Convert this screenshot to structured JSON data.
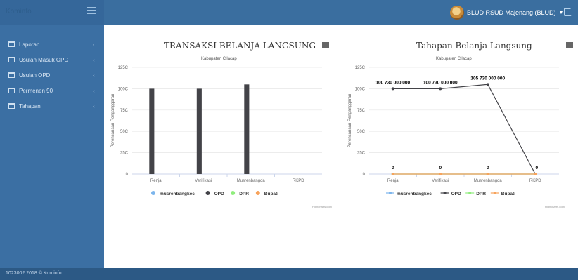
{
  "header": {
    "brand": "Kominfo",
    "user_label": "BLUD RSUD Majenang (BLUD)"
  },
  "sidebar": {
    "items": [
      {
        "label": "Laporan"
      },
      {
        "label": "Usulan Masuk OPD"
      },
      {
        "label": "Usulan OPD"
      },
      {
        "label": "Permenen 90"
      },
      {
        "label": "Tahapan"
      }
    ]
  },
  "footer": {
    "text": "1023002 2018 © Kominfo"
  },
  "colors": {
    "accent": "#3a6e9f",
    "sidebar": "#3b6fa3",
    "musrenbangkec": "#7cb5ec",
    "opd": "#434348",
    "dpr": "#90ed7d",
    "bupati": "#f7a35c"
  },
  "chart_data": [
    {
      "type": "bar",
      "title": "TRANSAKSI BELANJA LANGSUNG",
      "subtitle": "Kabupaten Cilacap",
      "ylabel": "Perencanaan Penganggaran",
      "ylim": [
        0,
        125
      ],
      "yticks": [
        "0",
        "25C",
        "50C",
        "75C",
        "100C",
        "125C"
      ],
      "categories": [
        "Renja",
        "Verifikasi",
        "Musrenbangda",
        "RKPD"
      ],
      "series": [
        {
          "name": "musrenbangkec",
          "values": [
            0,
            0,
            0,
            0
          ]
        },
        {
          "name": "OPD",
          "values": [
            100,
            100,
            105,
            0
          ]
        },
        {
          "name": "DPR",
          "values": [
            0,
            0,
            0,
            0
          ]
        },
        {
          "name": "Bupati",
          "values": [
            0,
            0,
            0,
            0
          ]
        }
      ],
      "credit": "Highcharts.com",
      "legend": "bottom"
    },
    {
      "type": "line",
      "title": "Tahapan Belanja Langsung",
      "subtitle": "Kabupaten Cilacap",
      "ylabel": "Perencanaan Penganggaran",
      "ylim": [
        0,
        125
      ],
      "yticks": [
        "0",
        "25C",
        "50C",
        "75C",
        "100C",
        "125C"
      ],
      "categories": [
        "Renja",
        "Verifikasi",
        "Musrenbangda",
        "RKPD"
      ],
      "series": [
        {
          "name": "musrenbangkec",
          "values": [
            0,
            0,
            0,
            0
          ]
        },
        {
          "name": "OPD",
          "values": [
            100,
            100,
            105,
            0
          ],
          "data_labels": [
            "100 730 000 000",
            "100 730 000 000",
            "105 730 000 000",
            "0"
          ]
        },
        {
          "name": "DPR",
          "values": [
            0,
            0,
            0,
            0
          ],
          "data_labels": [
            "0",
            "0",
            "0",
            ""
          ]
        },
        {
          "name": "Bupati",
          "values": [
            0,
            0,
            0,
            0
          ]
        }
      ],
      "credit": "Highcharts.com",
      "legend": "bottom"
    }
  ]
}
